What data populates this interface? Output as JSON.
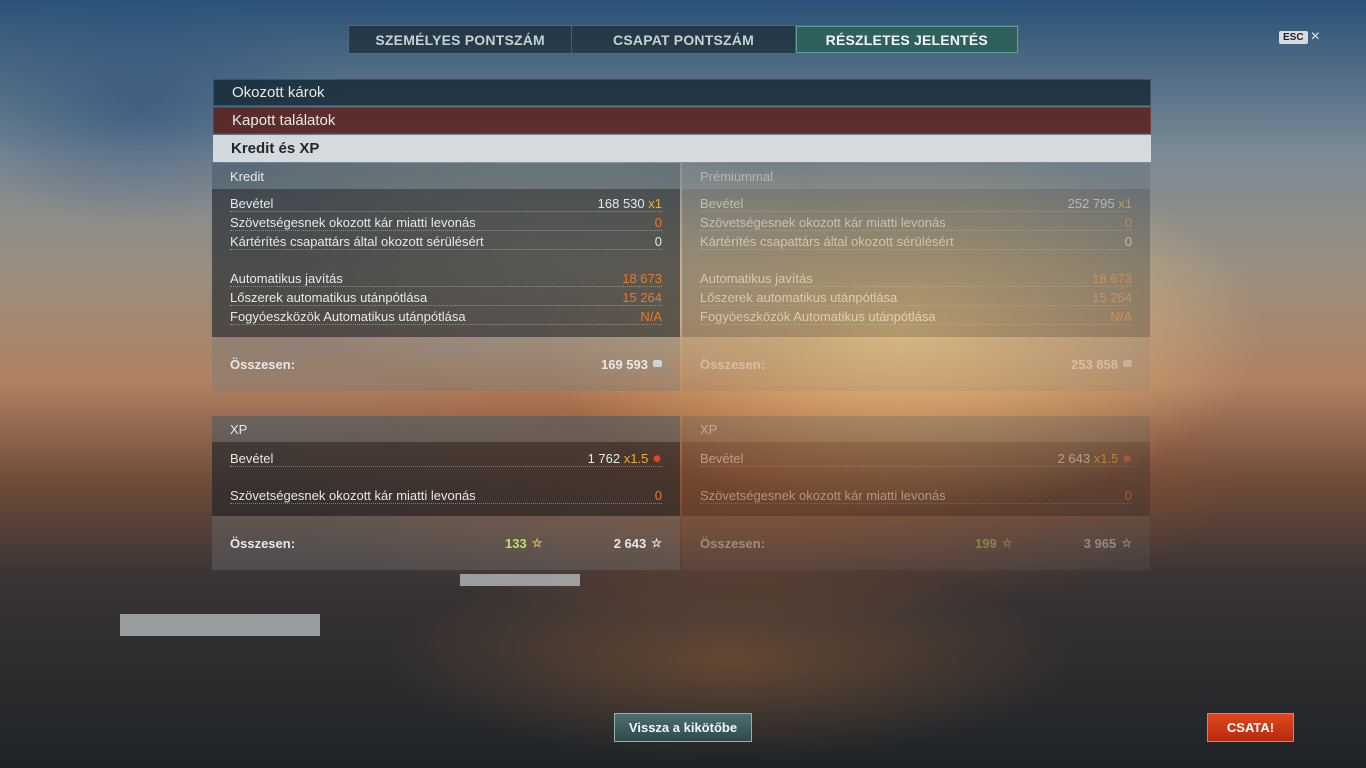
{
  "tabs": [
    {
      "label": "SZEMÉLYES PONTSZÁM",
      "active": false
    },
    {
      "label": "CSAPAT PONTSZÁM",
      "active": false
    },
    {
      "label": "RÉSZLETES JELENTÉS",
      "active": true
    }
  ],
  "esc": {
    "key": "ESC",
    "close": "×"
  },
  "sections": {
    "damage_dealt": "Okozott károk",
    "hits_received": "Kapott találatok",
    "credits_xp": "Kredit és XP"
  },
  "credits": {
    "header": "Kredit",
    "rows": [
      {
        "label": "Bevétel",
        "value": "168 530",
        "mult": "x1"
      },
      {
        "label": "Szövetségesnek okozott kár miatti levonás",
        "value": "0"
      },
      {
        "label": "Kártérítés csapattárs által okozott sérülésért",
        "value": "0"
      },
      {
        "label": "Automatikus javítás",
        "value": "18 673"
      },
      {
        "label": "Lőszerek automatikus utánpótlása",
        "value": "15 264"
      },
      {
        "label": "Fogyóeszközök Automatikus utánpótlása",
        "value": "N/A"
      }
    ],
    "total_label": "Összesen:",
    "total_value": "169 593"
  },
  "credits_premium": {
    "header": "Prémiummal",
    "rows": [
      {
        "label": "Bevétel",
        "value": "252 795",
        "mult": "x1"
      },
      {
        "label": "Szövetségesnek okozott kár miatti levonás",
        "value": "0"
      },
      {
        "label": "Kártérítés csapattárs által okozott sérülésért",
        "value": "0"
      },
      {
        "label": "Automatikus javítás",
        "value": "18 673"
      },
      {
        "label": "Lőszerek automatikus utánpótlása",
        "value": "15 264"
      },
      {
        "label": "Fogyóeszközök Automatikus utánpótlása",
        "value": "N/A"
      }
    ],
    "total_label": "Összesen:",
    "total_value": "253 858"
  },
  "xp": {
    "header": "XP",
    "rows": [
      {
        "label": "Bevétel",
        "value": "1 762",
        "mult": "x1.5"
      },
      {
        "label": "Szövetségesnek okozott kár miatti levonás",
        "value": "0"
      }
    ],
    "total_label": "Összesen:",
    "total_free": "133",
    "total_value": "2 643"
  },
  "xp_premium": {
    "header": "XP",
    "rows": [
      {
        "label": "Bevétel",
        "value": "2 643",
        "mult": "x1.5"
      },
      {
        "label": "Szövetségesnek okozott kár miatti levonás",
        "value": "0"
      }
    ],
    "total_label": "Összesen:",
    "total_free": "199",
    "total_value": "3 965"
  },
  "buttons": {
    "back": "Vissza a kikötőbe",
    "battle": "CSATA!"
  }
}
